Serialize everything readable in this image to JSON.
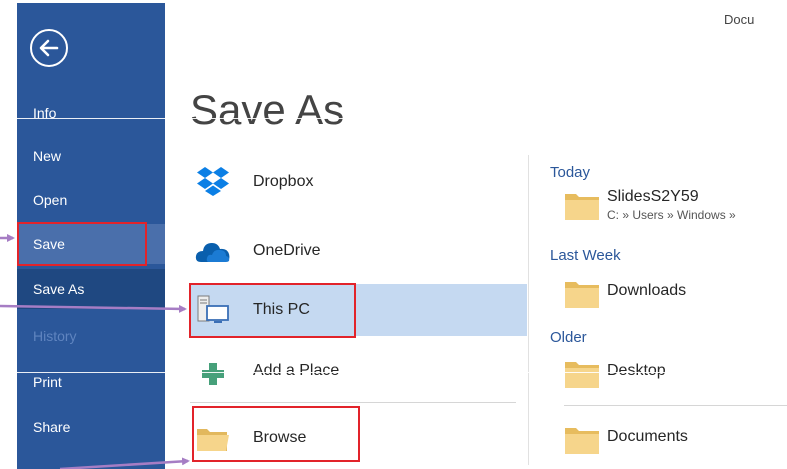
{
  "window": {
    "doc_title": "Docu"
  },
  "nav": {
    "items": [
      {
        "label": "Info"
      },
      {
        "label": "New"
      },
      {
        "label": "Open"
      },
      {
        "label": "Save"
      },
      {
        "label": "Save As"
      },
      {
        "label": "History"
      },
      {
        "label": "Print"
      },
      {
        "label": "Share"
      }
    ]
  },
  "main": {
    "title": "Save As",
    "places": [
      {
        "label": "Dropbox",
        "icon": "dropbox-icon"
      },
      {
        "label": "OneDrive",
        "icon": "onedrive-icon"
      },
      {
        "label": "This PC",
        "icon": "computer-icon",
        "selected": true
      },
      {
        "label": "Add a Place",
        "icon": "plus-icon"
      },
      {
        "label": "Browse",
        "icon": "folder-icon"
      }
    ],
    "recent": {
      "today_label": "Today",
      "last_week_label": "Last Week",
      "older_label": "Older",
      "today_items": [
        {
          "name": "SlidesS2Y59",
          "path": "C: » Users » Windows »"
        }
      ],
      "last_week_items": [
        {
          "name": "Downloads"
        }
      ],
      "older_items": [
        {
          "name": "Desktop"
        },
        {
          "name": "Documents"
        }
      ]
    }
  },
  "colors": {
    "nav_bg": "#2b579a",
    "nav_active": "#1f4881",
    "selected_bg": "#c5d9f1",
    "accent_text": "#2b579a",
    "annotation_red": "#e2232a",
    "annotation_arrow": "#a67dc4"
  }
}
